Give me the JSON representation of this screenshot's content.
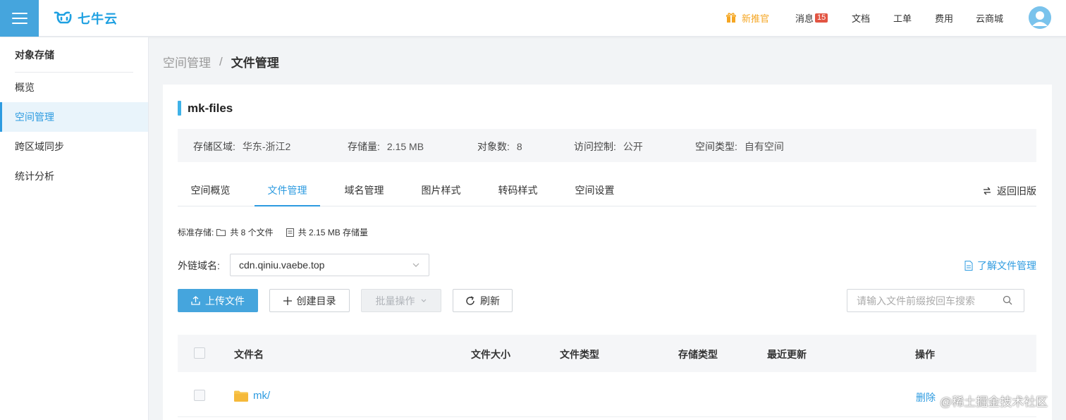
{
  "header": {
    "logo_text": "七牛云",
    "nav": {
      "new_user": "新推官",
      "messages": "消息",
      "message_count": "15",
      "docs": "文档",
      "tickets": "工单",
      "fees": "费用",
      "market": "云商城"
    }
  },
  "sidebar": {
    "title": "对象存储",
    "items": [
      {
        "label": "概览"
      },
      {
        "label": "空间管理"
      },
      {
        "label": "跨区域同步"
      },
      {
        "label": "统计分析"
      }
    ]
  },
  "breadcrumb": {
    "parent": "空间管理",
    "separator": "/",
    "current": "文件管理"
  },
  "bucket": {
    "name": "mk-files",
    "info": {
      "region_label": "存储区域:",
      "region_value": "华东-浙江2",
      "size_label": "存储量:",
      "size_value": "2.15 MB",
      "objects_label": "对象数:",
      "objects_value": "8",
      "access_label": "访问控制:",
      "access_value": "公开",
      "type_label": "空间类型:",
      "type_value": "自有空间"
    }
  },
  "tabs": [
    {
      "label": "空间概览"
    },
    {
      "label": "文件管理"
    },
    {
      "label": "域名管理"
    },
    {
      "label": "图片样式"
    },
    {
      "label": "转码样式"
    },
    {
      "label": "空间设置"
    }
  ],
  "back_old": "返回旧版",
  "storage_summary": {
    "label": "标准存储:",
    "files": "共 8 个文件",
    "size": "共 2.15 MB 存储量"
  },
  "domain": {
    "label": "外链域名:",
    "value": "cdn.qiniu.vaebe.top"
  },
  "learn_link": "了解文件管理",
  "toolbar": {
    "upload": "上传文件",
    "mkdir": "创建目录",
    "batch": "批量操作",
    "refresh": "刷新",
    "search_placeholder": "请输入文件前缀按回车搜索"
  },
  "table": {
    "columns": [
      "文件名",
      "文件大小",
      "文件类型",
      "存储类型",
      "最近更新",
      "操作"
    ],
    "rows": [
      {
        "name": "mk/",
        "action": "删除"
      }
    ]
  },
  "watermark": "@稀土掘金技术社区",
  "colors": {
    "accent": "#2d9be0",
    "menu_bg": "#45a5dd",
    "gift": "#f5a623",
    "badge": "#e25543"
  }
}
